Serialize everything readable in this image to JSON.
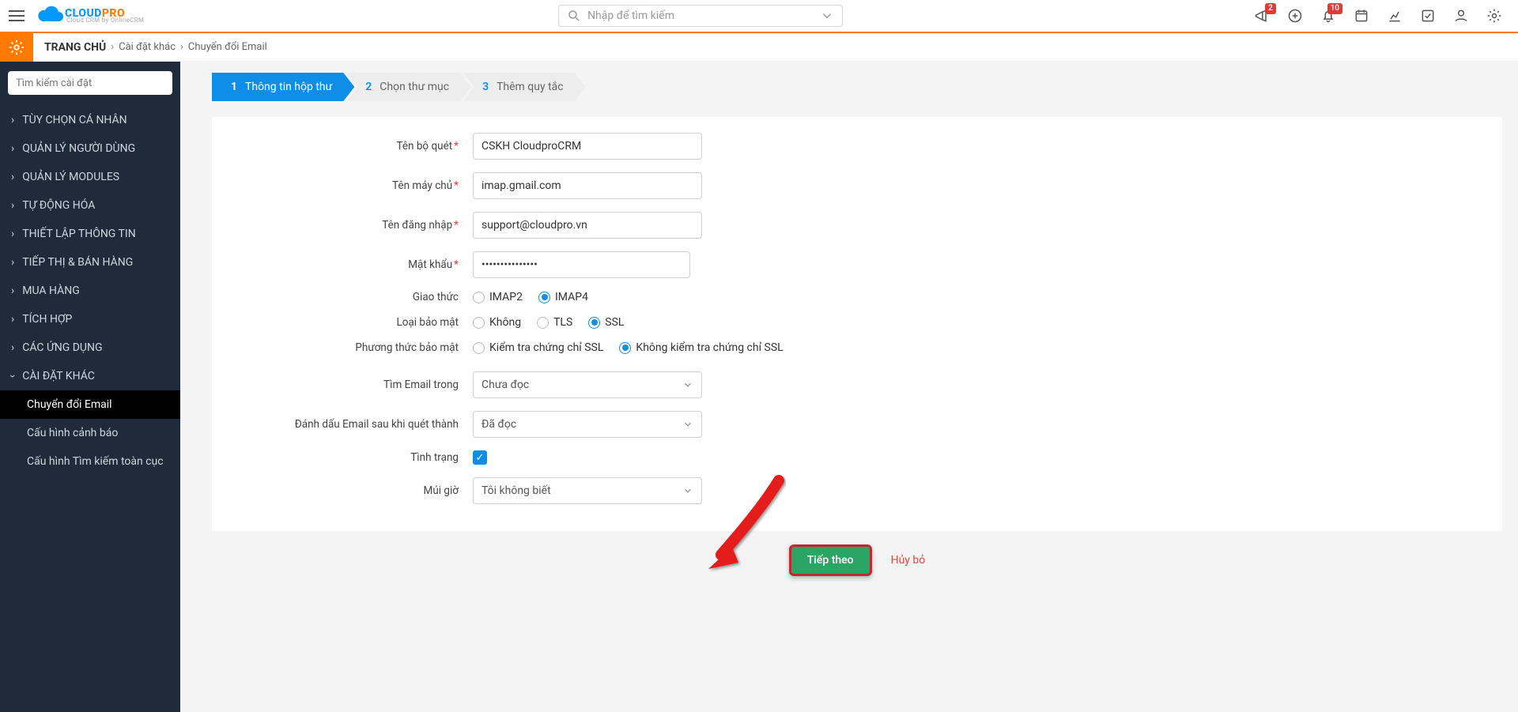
{
  "header": {
    "search_placeholder": "Nhập để tìm kiếm",
    "logo_cloud": "CLOUD",
    "logo_pro": "PRO",
    "logo_sub": "Cloud CRM by OnlineCRM",
    "badges": {
      "announce": "2",
      "bell": "10"
    }
  },
  "breadcrumb": {
    "home": "TRANG CHỦ",
    "b1": "Cài đặt khác",
    "b2": "Chuyển đổi Email"
  },
  "sidebar": {
    "search_placeholder": "Tìm kiếm cài đặt",
    "items": [
      "TÙY CHỌN CÁ NHÂN",
      "QUẢN LÝ NGƯỜI DÙNG",
      "QUẢN LÝ MODULES",
      "TỰ ĐỘNG HÓA",
      "THIẾT LẬP THÔNG TIN",
      "TIẾP THỊ & BÁN HÀNG",
      "MUA HÀNG",
      "TÍCH HỢP",
      "CÁC ỨNG DỤNG",
      "CÀI ĐẶT KHÁC"
    ],
    "sub_items": [
      "Chuyển đổi Email",
      "Cấu hình cảnh báo",
      "Cấu hình Tìm kiếm toàn cục"
    ]
  },
  "steps": {
    "s1": {
      "num": "1",
      "label": "Thông tin hộp thư"
    },
    "s2": {
      "num": "2",
      "label": "Chọn thư mục"
    },
    "s3": {
      "num": "3",
      "label": "Thêm quy tắc"
    }
  },
  "form": {
    "scanner_label": "Tên bộ quét",
    "scanner_value": "CSKH CloudproCRM",
    "server_label": "Tên máy chủ",
    "server_value": "imap.gmail.com",
    "login_label": "Tên đăng nhập",
    "login_value": "support@cloudpro.vn",
    "password_label": "Mật khẩu",
    "password_value": "•••••••••••••••",
    "protocol_label": "Giao thức",
    "protocol_opts": {
      "imap2": "IMAP2",
      "imap4": "IMAP4"
    },
    "security_label": "Loại bảo mật",
    "security_opts": {
      "none": "Không",
      "tls": "TLS",
      "ssl": "SSL"
    },
    "certcheck_label": "Phương thức bảo mật",
    "certcheck_opts": {
      "check": "Kiểm tra chứng chỉ SSL",
      "nocheck": "Không kiểm tra chứng chỉ SSL"
    },
    "findin_label": "Tìm Email trong",
    "findin_value": "Chưa đọc",
    "markafter_label": "Đánh dấu Email sau khi quét thành",
    "markafter_value": "Đã đọc",
    "status_label": "Tình trạng",
    "timezone_label": "Múi giờ",
    "timezone_value": "Tôi không biết"
  },
  "actions": {
    "next": "Tiếp theo",
    "cancel": "Hủy bỏ"
  }
}
